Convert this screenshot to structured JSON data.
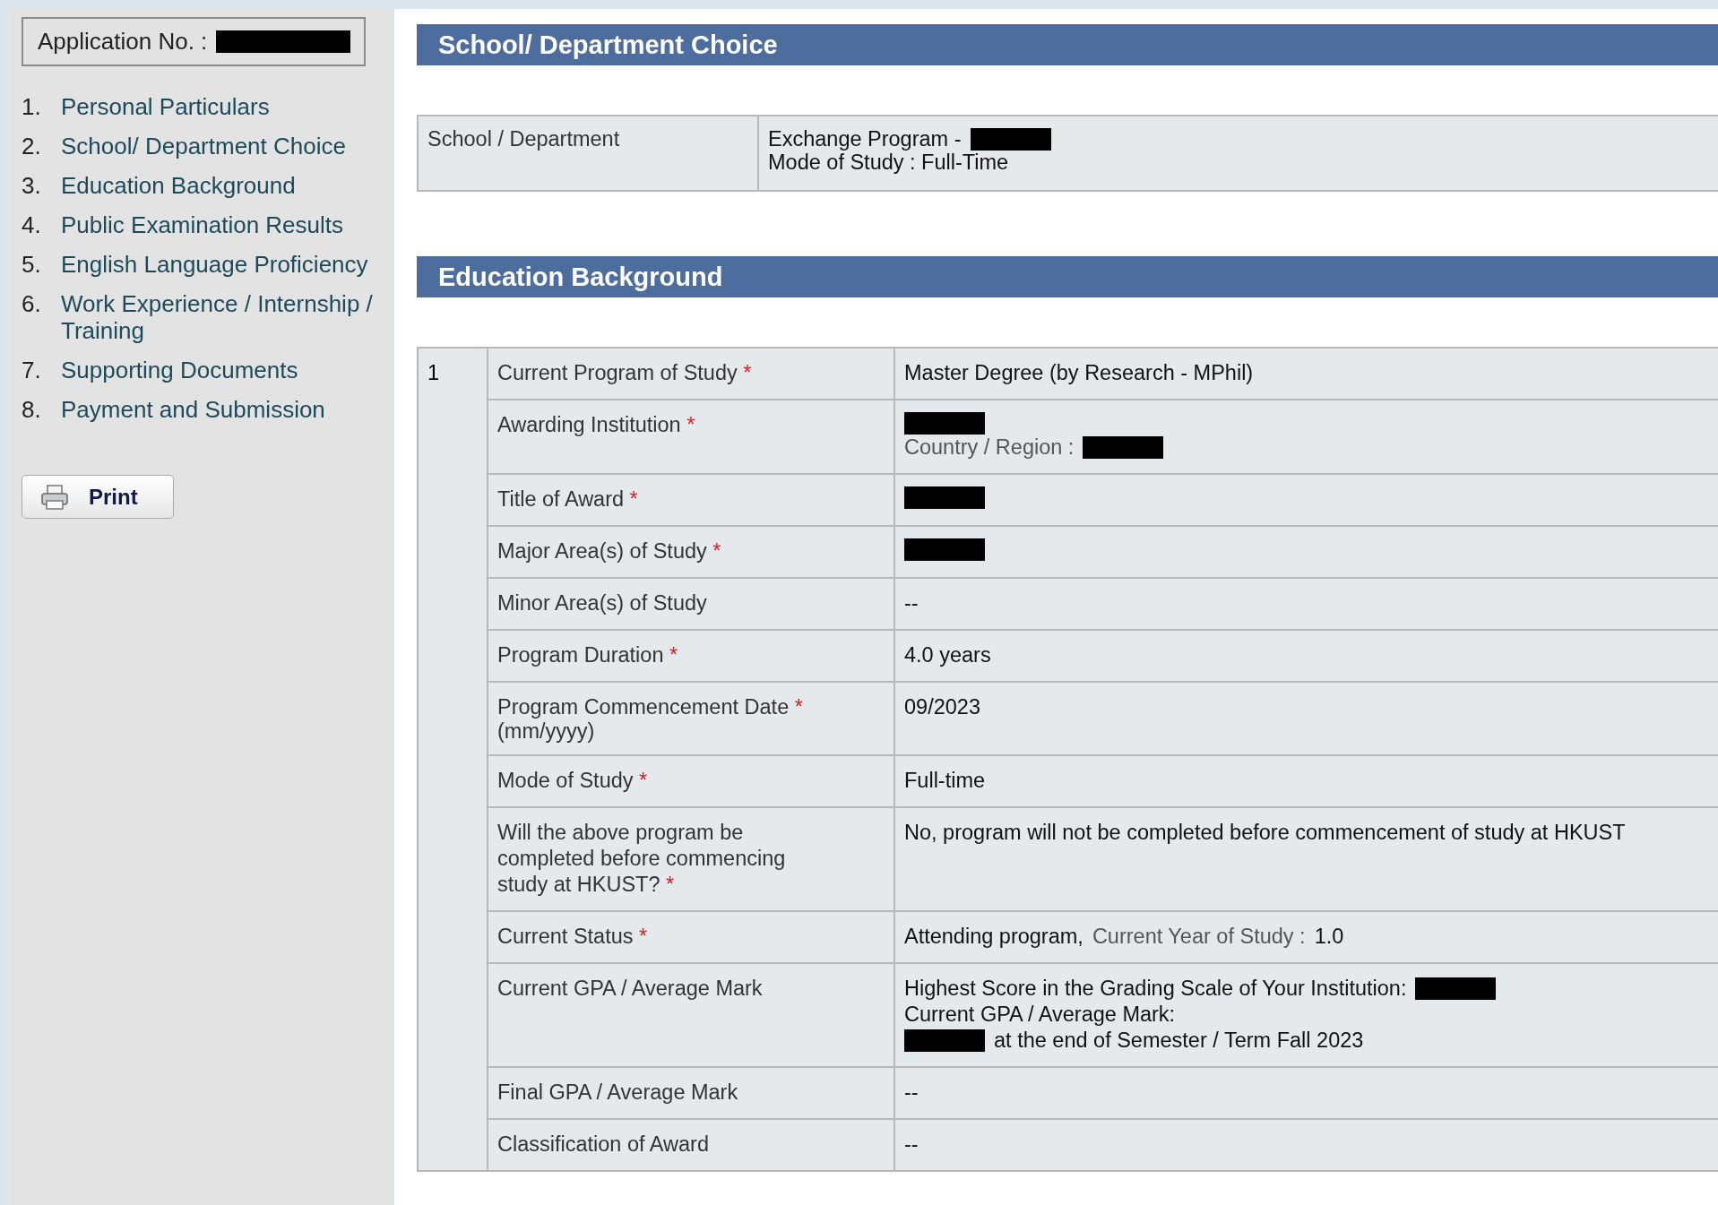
{
  "application": {
    "label": "Application No. :",
    "redacted": true
  },
  "nav": [
    {
      "number": "1.",
      "label": "Personal Particulars"
    },
    {
      "number": "2.",
      "label": "School/ Department Choice"
    },
    {
      "number": "3.",
      "label": "Education Background"
    },
    {
      "number": "4.",
      "label": "Public Examination Results"
    },
    {
      "number": "5.",
      "label": "English Language Proficiency"
    },
    {
      "number": "6.",
      "label": "Work Experience / Internship / Training"
    },
    {
      "number": "7.",
      "label": "Supporting Documents"
    },
    {
      "number": "8.",
      "label": "Payment and Submission"
    }
  ],
  "print_button": {
    "label": "Print"
  },
  "sections": [
    {
      "title": "School/ Department Choice",
      "kind": "plain",
      "entries": [
        {
          "rows": [
            {
              "label": "School / Department",
              "lines": [
                [
                  {
                    "kind": "text",
                    "text": "Exchange Program -"
                  },
                  {
                    "kind": "redacted"
                  }
                ],
                [
                  {
                    "kind": "text",
                    "text": "Mode of Study  :  Full-Time"
                  }
                ]
              ]
            }
          ]
        }
      ]
    },
    {
      "title": "Education Background",
      "kind": "numbered",
      "entries": [
        {
          "number": "1",
          "rows": [
            {
              "label": "Current Program of Study",
              "required_mark": "*",
              "lines": [
                [
                  {
                    "kind": "text",
                    "text": "Master Degree (by Research - MPhil)"
                  }
                ]
              ]
            },
            {
              "label": "Awarding Institution",
              "required_mark": "*",
              "lines": [
                [
                  {
                    "kind": "redacted"
                  }
                ],
                [
                  {
                    "kind": "muted",
                    "text": "Country / Region :"
                  },
                  {
                    "kind": "redacted"
                  }
                ]
              ]
            },
            {
              "label": "Title of Award",
              "required_mark": "*",
              "lines": [
                [
                  {
                    "kind": "redacted"
                  }
                ]
              ]
            },
            {
              "label": "Major Area(s) of Study",
              "required_mark": "*",
              "lines": [
                [
                  {
                    "kind": "redacted"
                  }
                ]
              ]
            },
            {
              "label": "Minor Area(s) of Study",
              "lines": [
                [
                  {
                    "kind": "text",
                    "text": "--"
                  }
                ]
              ]
            },
            {
              "label": "Program Duration",
              "required_mark": "*",
              "lines": [
                [
                  {
                    "kind": "text",
                    "text": "4.0 years"
                  }
                ]
              ]
            },
            {
              "label": "Program Commencement Date",
              "required_mark": "*",
              "note": "(mm/yyyy)",
              "lines": [
                [
                  {
                    "kind": "text",
                    "text": "09/2023"
                  }
                ]
              ]
            },
            {
              "label": "Mode of Study",
              "required_mark": "*",
              "lines": [
                [
                  {
                    "kind": "text",
                    "text": "Full-time"
                  }
                ]
              ]
            },
            {
              "label": "Will the above program be\ncompleted before commencing\nstudy at HKUST?",
              "required_mark": "*",
              "lines": [
                [
                  {
                    "kind": "text",
                    "text": "No, program will not be completed before commencement of study at HKUST"
                  }
                ]
              ]
            },
            {
              "label": "Current Status",
              "required_mark": "*",
              "lines": [
                [
                  {
                    "kind": "text",
                    "text": "Attending program,"
                  },
                  {
                    "kind": "muted",
                    "text": "Current Year of Study :"
                  },
                  {
                    "kind": "text",
                    "text": "1.0"
                  }
                ]
              ]
            },
            {
              "label": "Current GPA / Average Mark",
              "lines": [
                [
                  {
                    "kind": "text",
                    "text": "Highest Score in the Grading Scale of Your Institution:"
                  },
                  {
                    "kind": "redacted"
                  }
                ],
                [
                  {
                    "kind": "text",
                    "text": "Current GPA / Average Mark:"
                  }
                ],
                [
                  {
                    "kind": "redacted"
                  },
                  {
                    "kind": "text",
                    "text": "at the end of Semester / Term Fall 2023"
                  }
                ]
              ]
            },
            {
              "label": "Final GPA / Average Mark",
              "lines": [
                [
                  {
                    "kind": "text",
                    "text": "--"
                  }
                ]
              ]
            },
            {
              "label": "Classification of Award",
              "lines": [
                [
                  {
                    "kind": "text",
                    "text": "--"
                  }
                ]
              ]
            }
          ]
        }
      ]
    }
  ]
}
